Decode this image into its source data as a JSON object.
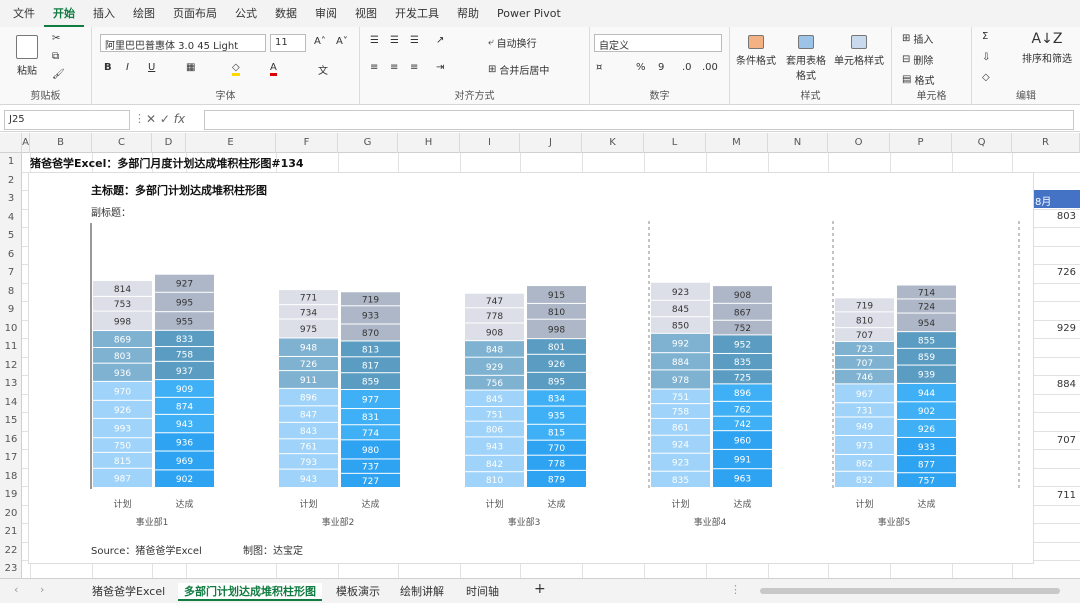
{
  "menu": [
    "文件",
    "开始",
    "插入",
    "绘图",
    "页面布局",
    "公式",
    "数据",
    "审阅",
    "视图",
    "开发工具",
    "帮助",
    "Power Pivot"
  ],
  "ribbon": {
    "paste": "粘贴",
    "clipboard": "剪贴板",
    "font_name": "阿里巴巴普惠体 3.0 45 Light",
    "font_size": "11",
    "font_group": "字体",
    "wrap": "自动换行",
    "merge": "合并后居中",
    "align_group": "对齐方式",
    "number_format": "自定义",
    "number_group": "数字",
    "cond_format": "条件格式",
    "table_format": "套用表格格式",
    "cell_style": "单元格样式",
    "style_group": "样式",
    "insert": "插入",
    "delete": "删除",
    "format": "格式",
    "cells_group": "单元格",
    "sort": "排序和筛选",
    "edit_group": "编辑"
  },
  "namebox": "J25",
  "columns": [
    "A",
    "B",
    "C",
    "D",
    "E",
    "F",
    "G",
    "H",
    "I",
    "J",
    "K",
    "L",
    "M",
    "N",
    "O",
    "P",
    "Q",
    "R"
  ],
  "rows": [
    "1",
    "2",
    "3",
    "4",
    "5",
    "6",
    "7",
    "8",
    "9",
    "10",
    "11",
    "12",
    "13",
    "14",
    "15",
    "16",
    "17",
    "18",
    "19",
    "20",
    "21",
    "22",
    "23"
  ],
  "a1_text": "猪爸爸学Excel：多部门月度计划达成堆积柱形图#134",
  "chart": {
    "main_title": "主标题：多部门计划达成堆积柱形图",
    "subtitle": "副标题：",
    "source": "Source：猪爸爸学Excel",
    "maker": "制图：达宝定"
  },
  "chart_data": {
    "type": "bar",
    "stacked": true,
    "categories": [
      "事业部1",
      "事业部2",
      "事业部3",
      "事业部4",
      "事业部5"
    ],
    "bar_labels": [
      "计划",
      "达成"
    ],
    "segment_order": "bottom-to-top",
    "groups": [
      {
        "name": "事业部1",
        "plan": [
          987,
          815,
          750,
          993,
          926,
          970,
          936,
          803,
          869,
          998,
          753,
          814
        ],
        "actual": [
          902,
          969,
          936,
          943,
          874,
          909,
          937,
          758,
          833,
          955,
          995,
          927
        ]
      },
      {
        "name": "事业部2",
        "plan": [
          943,
          793,
          761,
          843,
          847,
          896,
          911,
          726,
          948,
          975,
          734,
          771
        ],
        "actual": [
          727,
          737,
          980,
          774,
          831,
          977,
          859,
          817,
          813,
          870,
          933,
          719
        ]
      },
      {
        "name": "事业部3",
        "plan": [
          810,
          842,
          943,
          806,
          751,
          845,
          756,
          929,
          848,
          908,
          778,
          747
        ],
        "actual": [
          879,
          778,
          770,
          815,
          935,
          834,
          895,
          926,
          801,
          998,
          810,
          915
        ]
      },
      {
        "name": "事业部4",
        "plan": [
          835,
          923,
          924,
          861,
          758,
          751,
          978,
          884,
          992,
          850,
          845,
          923
        ],
        "actual": [
          963,
          991,
          960,
          742,
          762,
          896,
          725,
          835,
          952,
          752,
          867,
          908
        ]
      },
      {
        "name": "事业部5",
        "plan": [
          832,
          862,
          973,
          949,
          731,
          967,
          746,
          707,
          723,
          707,
          810,
          719
        ],
        "actual": [
          757,
          877,
          933,
          926,
          902,
          944,
          939,
          859,
          855,
          954,
          724,
          714
        ]
      }
    ],
    "segment_colors_bottom_to_top": [
      "#9fd3f9",
      "#9fd3f9",
      "#9fd3f9",
      "#9fd3f9",
      "#9fd3f9",
      "#9fd3f9",
      "#7fb2d1",
      "#7fb2d1",
      "#7fb2d1",
      "#dcdfe8",
      "#dcdfe8",
      "#dcdfe8"
    ],
    "actual_colors_bottom_to_top": [
      "#2ea3f2",
      "#2ea3f2",
      "#2ea3f2",
      "#3fb0f5",
      "#3fb0f5",
      "#3fb0f5",
      "#5a9cc2",
      "#5a9cc2",
      "#5a9cc2",
      "#aeb7c7",
      "#aeb7c7",
      "#aeb7c7"
    ]
  },
  "right_cells": {
    "header": "8月",
    "values": [
      "803",
      "726",
      "929",
      "884",
      "707",
      "711"
    ]
  },
  "tabs": [
    "猪爸爸学Excel",
    "多部门计划达成堆积柱形图",
    "模板演示",
    "绘制讲解",
    "时间轴"
  ]
}
